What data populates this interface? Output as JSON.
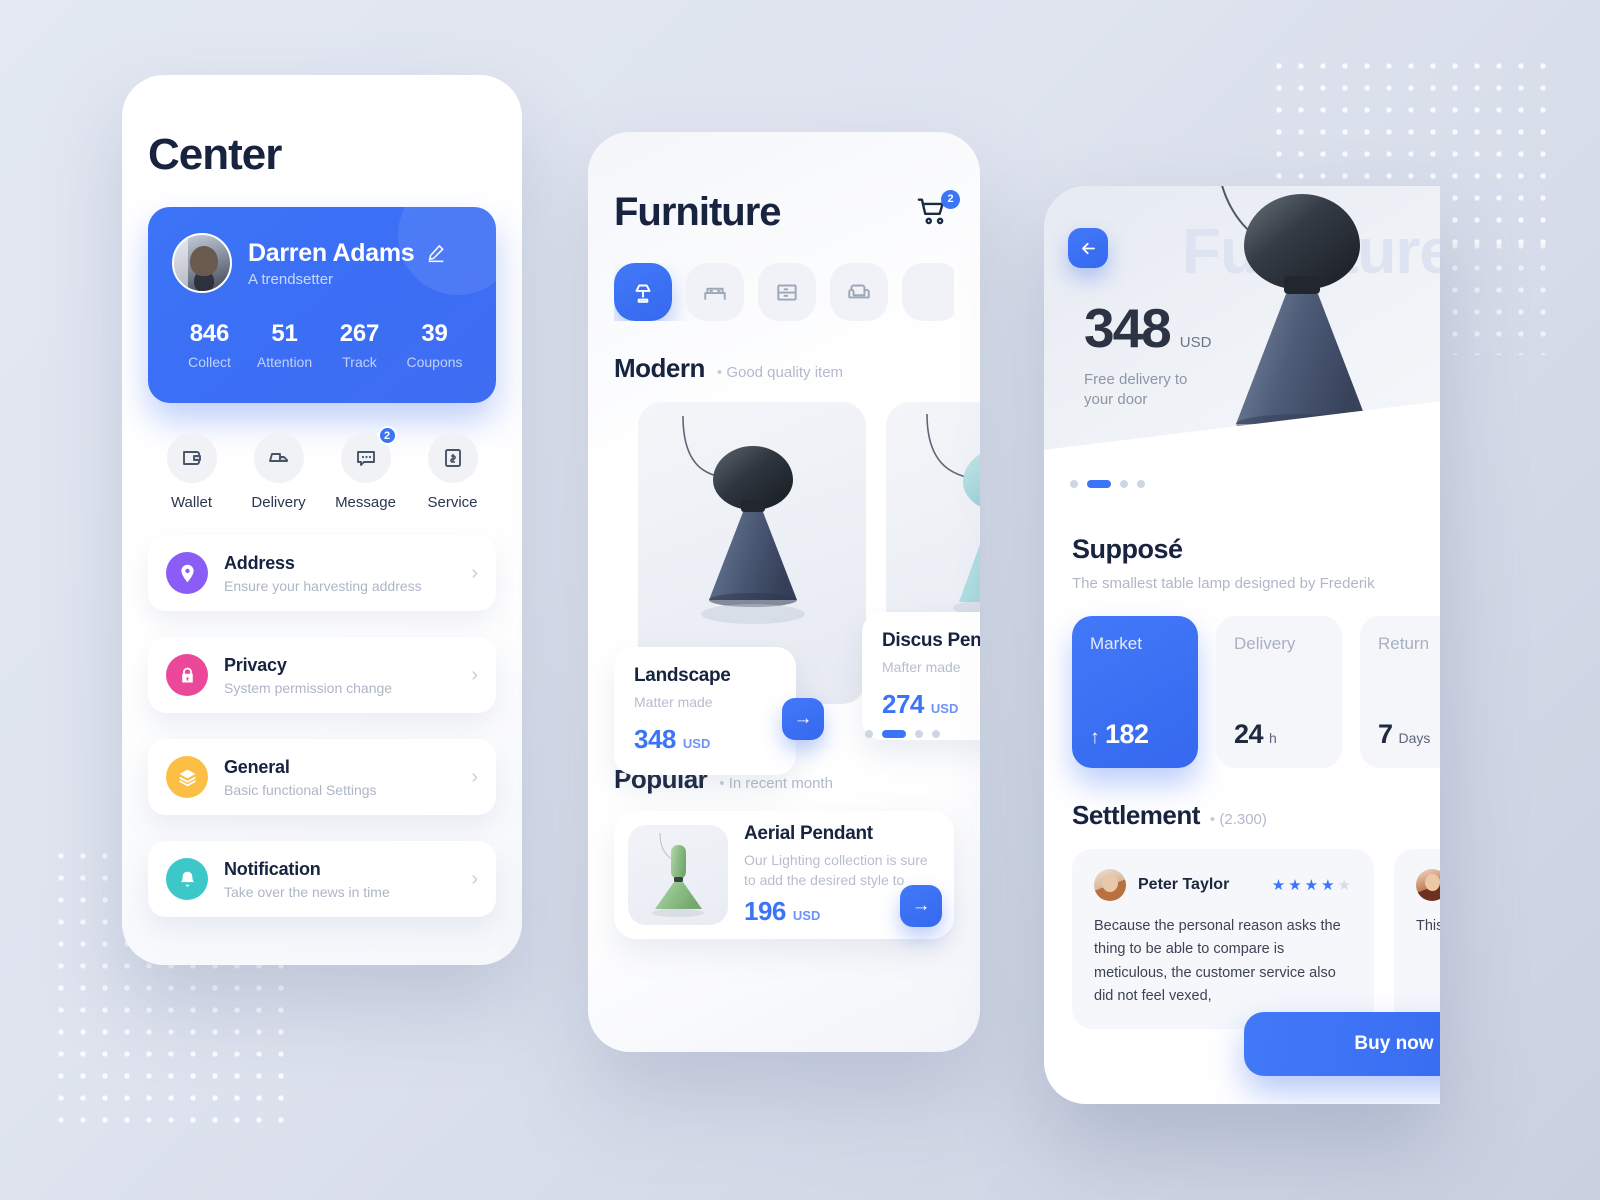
{
  "left": {
    "title": "Center",
    "profile": {
      "name": "Darren Adams",
      "subtitle": "A trendsetter",
      "edit_icon": "pencil-icon",
      "stats": [
        {
          "value": "846",
          "label": "Collect"
        },
        {
          "value": "51",
          "label": "Attention"
        },
        {
          "value": "267",
          "label": "Track"
        },
        {
          "value": "39",
          "label": "Coupons"
        }
      ]
    },
    "quick_actions": [
      {
        "label": "Wallet",
        "icon": "wallet-icon",
        "badge": ""
      },
      {
        "label": "Delivery",
        "icon": "truck-icon",
        "badge": ""
      },
      {
        "label": "Message",
        "icon": "message-icon",
        "badge": "2"
      },
      {
        "label": "Service",
        "icon": "receipt-icon",
        "badge": ""
      }
    ],
    "menu": [
      {
        "title": "Address",
        "sub": "Ensure your harvesting address",
        "icon": "location-pin-icon",
        "color": "#8b5cf6",
        "chevron": "›"
      },
      {
        "title": "Privacy",
        "sub": "System permission change",
        "icon": "lock-icon",
        "color": "#ec4899",
        "chevron": "›"
      },
      {
        "title": "General",
        "sub": "Basic functional Settings",
        "icon": "layers-icon",
        "color": "#fbbf45",
        "chevron": "›"
      },
      {
        "title": "Notification",
        "sub": "Take over the news in time",
        "icon": "bell-icon",
        "color": "#3cc8c8",
        "chevron": "›"
      }
    ]
  },
  "mid": {
    "title": "Furniture",
    "cart_icon": "shopping-cart-icon",
    "cart_badge": "2",
    "categories": [
      {
        "icon": "lamp-icon",
        "active": true
      },
      {
        "icon": "bed-icon",
        "active": false
      },
      {
        "icon": "dresser-icon",
        "active": false
      },
      {
        "icon": "sofa-icon",
        "active": false
      },
      {
        "icon": "more-icon",
        "active": false
      }
    ],
    "modern": {
      "title": "Modern",
      "note": "Good quality item"
    },
    "products": [
      {
        "name": "Landscape",
        "sub": "Matter made",
        "price": "348",
        "currency": "USD",
        "color": "#4a5a78"
      },
      {
        "name": "Discus Pendant",
        "sub": "Mafter made",
        "price": "274",
        "currency": "USD",
        "color": "#a8dade"
      }
    ],
    "carousel_dots": 4,
    "carousel_active": 1,
    "popular": {
      "title": "Popular",
      "note": "In recent month"
    },
    "popular_item": {
      "name": "Aerial Pendant",
      "desc": "Our Lighting collection is sure to add the desired style to",
      "price": "196",
      "currency": "USD"
    },
    "go_label": "→"
  },
  "right": {
    "ghost_word": "Furniture",
    "back_icon": "arrow-left-icon",
    "price": "348",
    "currency": "USD",
    "delivery_note": "Free delivery to\nyour door",
    "hero_dots": 4,
    "hero_active": 1,
    "product_name": "Supposé",
    "product_desc": "The smallest table lamp designed by Frederik",
    "specs": [
      {
        "key": "Market",
        "num": "182",
        "unit": "",
        "prefix": "↑",
        "active": true
      },
      {
        "key": "Delivery",
        "num": "24",
        "unit": "h",
        "prefix": "",
        "active": false
      },
      {
        "key": "Return",
        "num": "7",
        "unit": "Days",
        "prefix": "",
        "active": false
      }
    ],
    "settlement": {
      "title": "Settlement",
      "count": "(2.300)"
    },
    "reviews": [
      {
        "name": "Peter Taylor",
        "rating": 4,
        "max_rating": 5,
        "body": "Because the personal reason asks the thing to be able to compare is meticulous, the customer service also did not feel vexed,"
      },
      {
        "name": "",
        "rating": 0,
        "max_rating": 5,
        "body": "This temp prac"
      }
    ],
    "buy_label": "Buy now"
  }
}
